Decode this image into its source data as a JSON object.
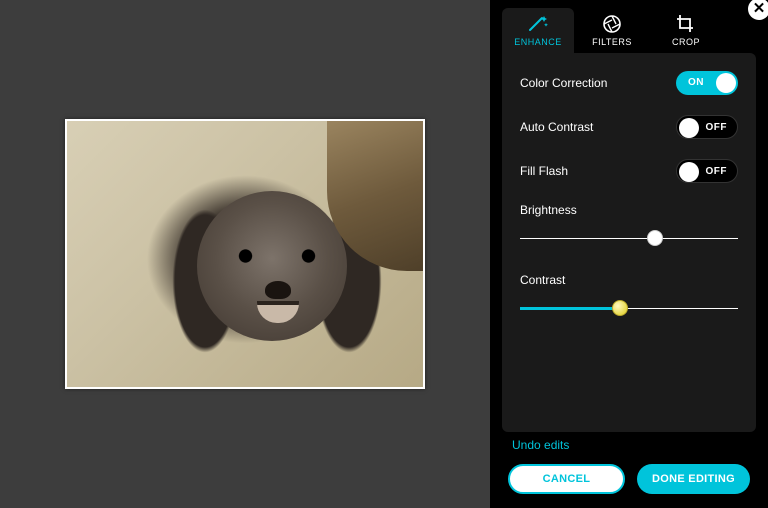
{
  "accent": "#00c4db",
  "tabs": {
    "enhance": "ENHANCE",
    "filters": "FILTERS",
    "crop": "CROP",
    "active": "enhance"
  },
  "controls": {
    "color_correction": {
      "label": "Color Correction",
      "state": "ON",
      "on": true
    },
    "auto_contrast": {
      "label": "Auto Contrast",
      "state": "OFF",
      "on": false
    },
    "fill_flash": {
      "label": "Fill Flash",
      "state": "OFF",
      "on": false
    }
  },
  "sliders": {
    "brightness": {
      "label": "Brightness",
      "value": 62,
      "min": 0,
      "max": 100
    },
    "contrast": {
      "label": "Contrast",
      "value": 46,
      "min": 0,
      "max": 100
    }
  },
  "footer": {
    "undo": "Undo edits",
    "cancel": "CANCEL",
    "done": "DONE EDITING"
  }
}
